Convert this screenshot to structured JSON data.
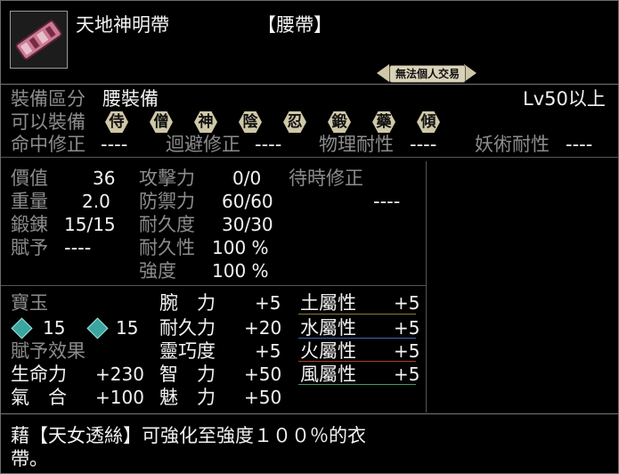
{
  "item": {
    "name": "天地神明帶",
    "type": "【腰帶】",
    "trade_badge": "無法個人交易"
  },
  "equip": {
    "category_label": "裝備區分",
    "category_value": "腰裝備",
    "level_req": "Lv50以上",
    "usable_label": "可以裝備",
    "classes": [
      "侍",
      "僧",
      "神",
      "陰",
      "忍",
      "鍛",
      "藥",
      "傾"
    ]
  },
  "mods": [
    {
      "label": "命中修正",
      "value": "----"
    },
    {
      "label": "迴避修正",
      "value": "----"
    },
    {
      "label": "物理耐性",
      "value": "----"
    },
    {
      "label": "妖術耐性",
      "value": "----"
    }
  ],
  "stats": {
    "price_label": "價值",
    "price_value": "36",
    "weight_label": "重量",
    "weight_value": "2.0",
    "forge_label": "鍛錬",
    "forge_value": "15/15",
    "grant_label": "賦予",
    "grant_value": "----",
    "attack_label": "攻擊力",
    "attack_value": "0/0",
    "defense_label": "防禦力",
    "defense_value": "60/60",
    "durability_label": "耐久度",
    "durability_value": "30/30",
    "durability_rate_label": "耐久性",
    "durability_rate_value": "100 %",
    "strength_label": "強度",
    "strength_value": "100 %",
    "wait_label": "待時修正",
    "wait_value": "----"
  },
  "jewel": {
    "label": "寶玉",
    "slots": [
      "15",
      "15"
    ]
  },
  "effects_label": "賦予效果",
  "effects_left": [
    {
      "label": "生命力",
      "value": "+230"
    },
    {
      "label": "氣　合",
      "value": "+100"
    }
  ],
  "effects_mid": [
    {
      "label": "腕　力",
      "value": "+5"
    },
    {
      "label": "耐久力",
      "value": "+20"
    },
    {
      "label": "靈巧度",
      "value": "+5"
    },
    {
      "label": "智　力",
      "value": "+50"
    },
    {
      "label": "魅　力",
      "value": "+50"
    }
  ],
  "elements": [
    {
      "label": "土屬性",
      "value": "+5"
    },
    {
      "label": "水屬性",
      "value": "+5"
    },
    {
      "label": "火屬性",
      "value": "+5"
    },
    {
      "label": "風屬性",
      "value": "+5"
    }
  ],
  "description": {
    "line1": "藉【天女透絲】可強化至強度１００％的衣",
    "line2": "帶。"
  },
  "colors": {
    "earth_line": "#8a7a3a",
    "water_line": "#3a6ab0",
    "fire_line": "#b04030",
    "wind_line": "#3aa060",
    "gem": "#3aa6a0"
  }
}
